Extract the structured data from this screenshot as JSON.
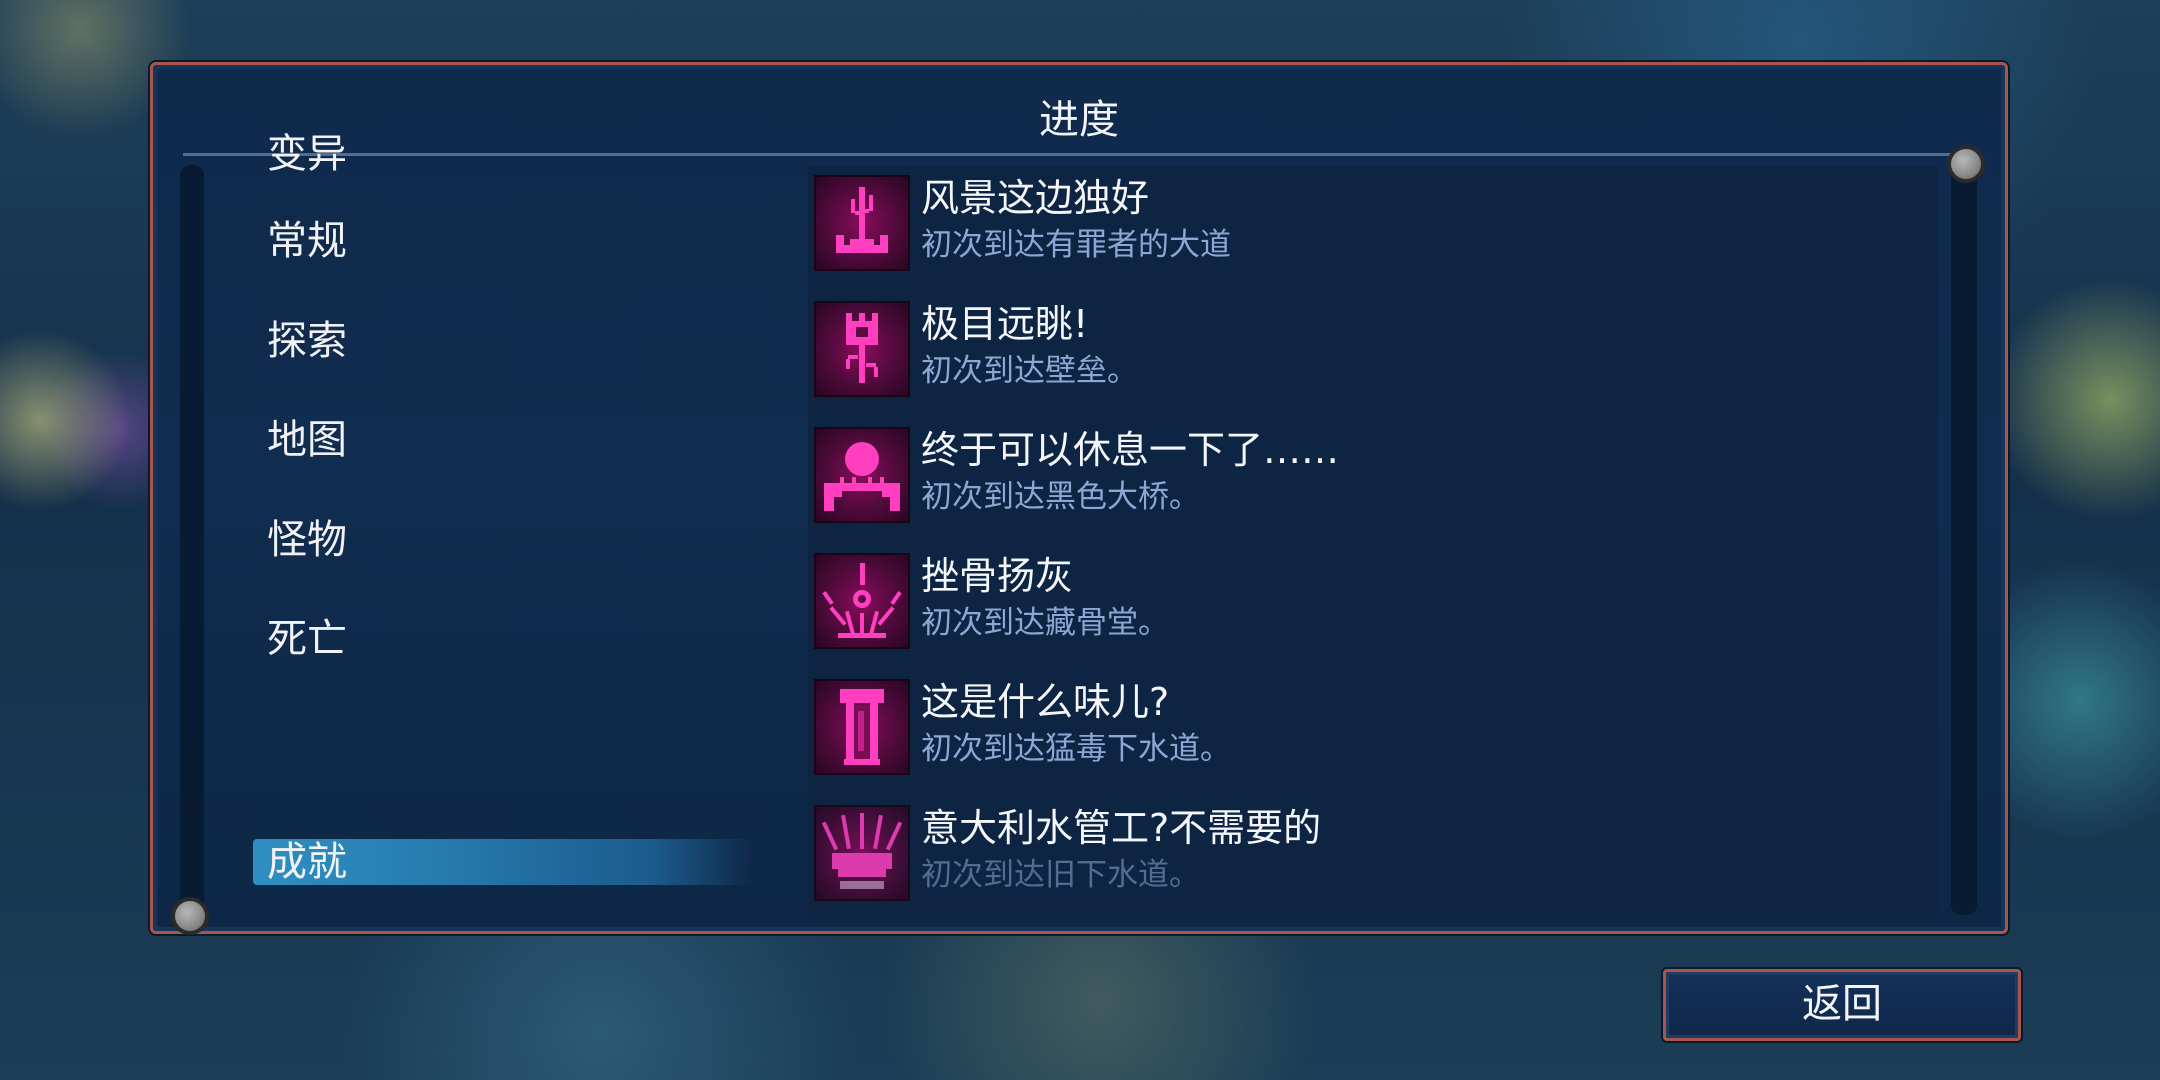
{
  "panel": {
    "title": "进度"
  },
  "categories": [
    {
      "label": "变异",
      "selected": false
    },
    {
      "label": "常规",
      "selected": false
    },
    {
      "label": "探索",
      "selected": false
    },
    {
      "label": "地图",
      "selected": false
    },
    {
      "label": "怪物",
      "selected": false
    },
    {
      "label": "死亡",
      "selected": false
    },
    {
      "label": "成就",
      "selected": true
    }
  ],
  "achievements": [
    {
      "title": "风景这边独好",
      "description": "初次到达有罪者的大道",
      "icon": "tower-spire-icon"
    },
    {
      "title": "极目远眺!",
      "description": "初次到达壁垒。",
      "icon": "rampart-tower-icon"
    },
    {
      "title": "终于可以休息一下了……",
      "description": "初次到达黑色大桥。",
      "icon": "bridge-sun-icon"
    },
    {
      "title": "挫骨扬灰",
      "description": "初次到达藏骨堂。",
      "icon": "ossuary-burst-icon"
    },
    {
      "title": "这是什么味儿?",
      "description": "初次到达猛毒下水道。",
      "icon": "sewer-pipe-icon"
    },
    {
      "title": "意大利水管工?不需要的",
      "description": "初次到达旧下水道。",
      "icon": "old-sewer-icon"
    }
  ],
  "footer": {
    "back_label": "返回"
  },
  "colors": {
    "panel_border": "#a9564a",
    "selected_highlight": "#2f8fc2",
    "icon_magenta": "#ff2fb8",
    "description_text": "#8fa6d4"
  }
}
